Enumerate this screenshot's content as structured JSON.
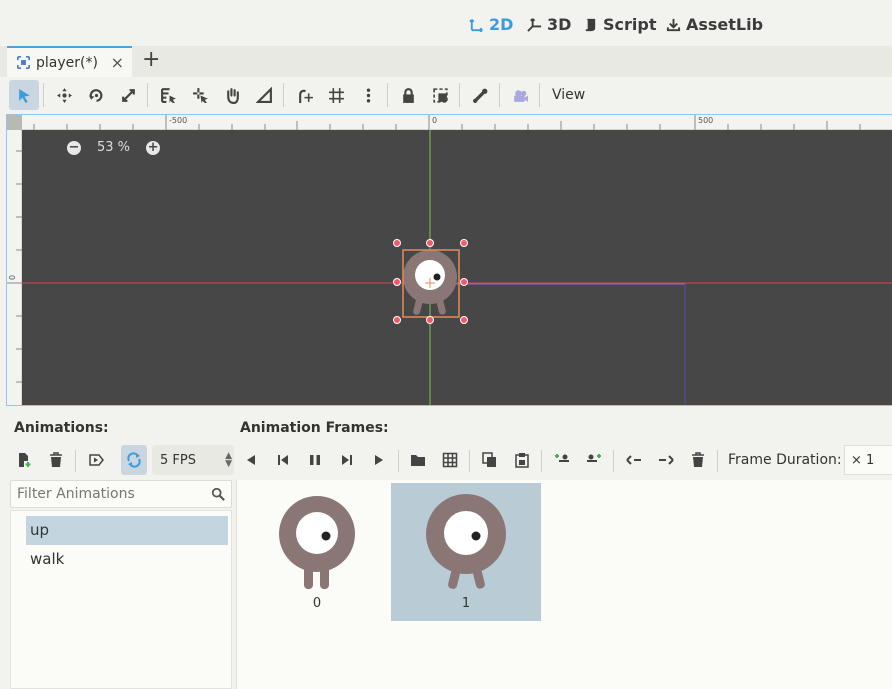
{
  "workspaces": [
    {
      "label": "2D",
      "active": true
    },
    {
      "label": "3D",
      "active": false
    },
    {
      "label": "Script",
      "active": false
    },
    {
      "label": "AssetLib",
      "active": false
    }
  ],
  "scene_tab": {
    "label": "player(*)",
    "close_glyph": "×",
    "add_glyph": "+"
  },
  "canvas_toolbar": {
    "view_label": "View",
    "tools": [
      "select-icon",
      "move-icon",
      "rotate-icon",
      "scale-icon",
      "list-select-icon",
      "pivot-icon",
      "pan-icon",
      "ruler-icon",
      "smart-snap-icon",
      "grid-snap-icon",
      "more-icon",
      "lock-icon",
      "group-icon",
      "skeleton-icon",
      "camera-override-icon"
    ]
  },
  "viewport": {
    "zoom_percent": "53 %",
    "zoom_out_glyph": "−",
    "zoom_in_glyph": "+",
    "ruler_labels": [
      "-500",
      "0",
      "500"
    ],
    "ruler_left_label": "0",
    "colors": {
      "background": "#474747",
      "x_axis": "#d04848",
      "y_axis": "#7fbf57",
      "selection": "#e88a5a",
      "handle": "#f05a68"
    }
  },
  "animations_panel": {
    "title": "Animations:",
    "fps_value": "5 FPS",
    "filter_placeholder": "Filter Animations",
    "items": [
      {
        "label": "up",
        "selected": true
      },
      {
        "label": "walk",
        "selected": false
      }
    ]
  },
  "frames_panel": {
    "title": "Animation Frames:",
    "frame_duration_label": "Frame Duration:",
    "frame_duration_value": "× 1",
    "frames": [
      {
        "index": "0",
        "selected": false
      },
      {
        "index": "1",
        "selected": true
      }
    ]
  },
  "accent_color": "#3d9be0"
}
